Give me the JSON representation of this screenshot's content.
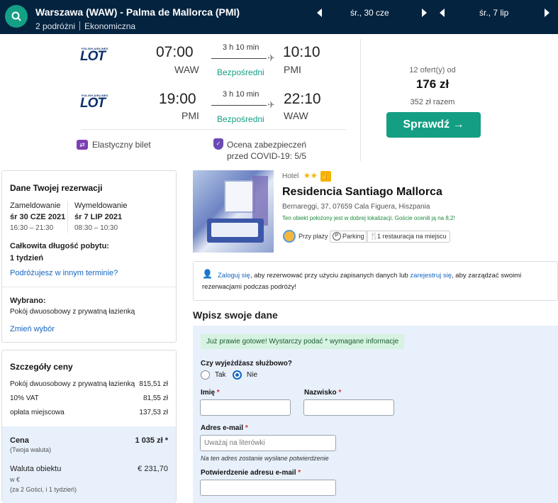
{
  "topbar": {
    "route": "Warszawa (WAW) - Palma de Mallorca (PMI)",
    "travellers": "2 podróżni",
    "cabin": "Ekonomiczna",
    "depart_date": "śr., 30 cze",
    "return_date": "śr., 7 lip"
  },
  "flights": [
    {
      "airline_small": "POLISH AIRLINES",
      "airline": "LOT",
      "dep_time": "07:00",
      "dep_airport": "WAW",
      "duration": "3 h 10 min",
      "stops": "Bezpośredni",
      "arr_time": "10:10",
      "arr_airport": "PMI"
    },
    {
      "airline_small": "POLISH AIRLINES",
      "airline": "LOT",
      "dep_time": "19:00",
      "dep_airport": "PMI",
      "duration": "3 h 10 min",
      "stops": "Bezpośredni",
      "arr_time": "22:10",
      "arr_airport": "WAW"
    }
  ],
  "flight_extras": {
    "flexible": "Elastyczny bilet",
    "covid_line1": "Ocena zabezpieczeń",
    "covid_line2": "przed COVID-19: 5/5"
  },
  "offer": {
    "count": "12 ofert(y) od",
    "price": "176 zł",
    "total": "352 zł razem",
    "button": "Sprawdź →"
  },
  "reservation": {
    "title": "Dane Twojej rezerwacji",
    "checkin_label": "Zameldowanie",
    "checkin_date": "śr 30 CZE 2021",
    "checkin_time": "16:30 – 21:30",
    "checkout_label": "Wymeldowanie",
    "checkout_date": "śr 7 LIP 2021",
    "checkout_time": "08:30 – 10:30",
    "length_label": "Całkowita długość pobytu:",
    "length_value": "1 tydzień",
    "other_dates_link": "Podróżujesz w innym terminie?",
    "selected_label": "Wybrano:",
    "selected_value": "Pokój dwuosobowy z prywatną łazienką",
    "change_link": "Zmień wybór"
  },
  "price_details": {
    "title": "Szczegóły ceny",
    "rows": [
      {
        "label": "Pokój dwuosobowy z prywatną łazienką",
        "value": "815,51 zł"
      },
      {
        "label": "10% VAT",
        "value": "81,55 zł"
      },
      {
        "label": "opłata miejscowa",
        "value": "137,53 zł"
      }
    ],
    "total_label": "Cena",
    "total_sub": "(Twoja waluta)",
    "total_value": "1 035 zł *",
    "currency_label": "Waluta obiektu",
    "currency_sub1": "w €",
    "currency_sub2": "(za 2 Gości,   i 1 tydzień)",
    "currency_value": "€ 231,70"
  },
  "hotel": {
    "label": "Hotel",
    "stars": "★★",
    "thumb": "👍",
    "name": "Residencia Santiago Mallorca",
    "address": "Bernareggi, 37, 07659 Cala Figuera, Hiszpania",
    "location_note": "Ten obiekt położony jest w dobrej lokalizacji. Goście ocenili ją na 8,2!",
    "features": [
      "Przy plaży",
      "Parking",
      "1 restauracja na miejscu"
    ]
  },
  "login": {
    "link1": "Zaloguj się",
    "text1": ", aby rezerwować przy użyciu zapisanych danych lub ",
    "link2": "zarejestruj się",
    "text2": ", aby zarządzać swoimi",
    "line2": "rezerwacjami podczas podróży!"
  },
  "form": {
    "heading": "Wpisz swoje dane",
    "ready_note": "Już prawie gotowe! Wystarczy podać * wymagane informacje",
    "business_q": "Czy wyjeżdżasz służbowo?",
    "yes": "Tak",
    "no": "Nie",
    "first_name": "Imię",
    "last_name": "Nazwisko",
    "email": "Adres e-mail",
    "email_placeholder": "Uważaj na literówki",
    "email_note": "Na ten adres zostanie wysłane potwierdzenie",
    "email_confirm": "Potwierdzenie adresu e-mail",
    "required_mark": "*"
  }
}
